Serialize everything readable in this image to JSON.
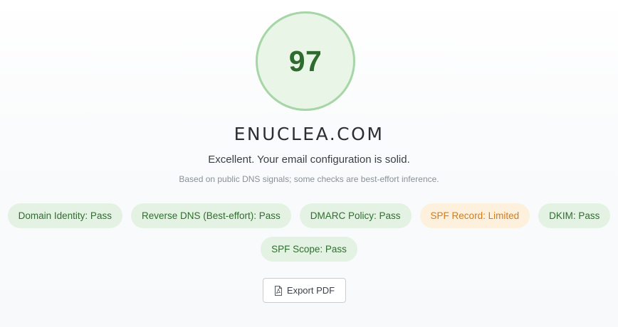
{
  "score": {
    "value": "97",
    "ring_color": "#a6d5a6",
    "fill_color": "#e8f5e7",
    "text_color": "#2f6b2f"
  },
  "domain": "ENUCLEA.COM",
  "summary": "Excellent. Your email configuration is solid.",
  "note": "Based on public DNS signals; some checks are best-effort inference.",
  "checks": [
    {
      "label": "Domain Identity: Pass",
      "status": "pass"
    },
    {
      "label": "Reverse DNS (Best-effort): Pass",
      "status": "pass"
    },
    {
      "label": "DMARC Policy: Pass",
      "status": "pass"
    },
    {
      "label": "SPF Record: Limited",
      "status": "limited"
    },
    {
      "label": "DKIM: Pass",
      "status": "pass"
    },
    {
      "label": "SPF Scope: Pass",
      "status": "pass"
    }
  ],
  "status_colors": {
    "pass_bg": "#e3f2e2",
    "pass_text": "#2f6e2f",
    "limited_bg": "#fdf0dc",
    "limited_text": "#d77a14"
  },
  "export": {
    "label": "Export PDF",
    "icon": "pdf-file-icon"
  }
}
